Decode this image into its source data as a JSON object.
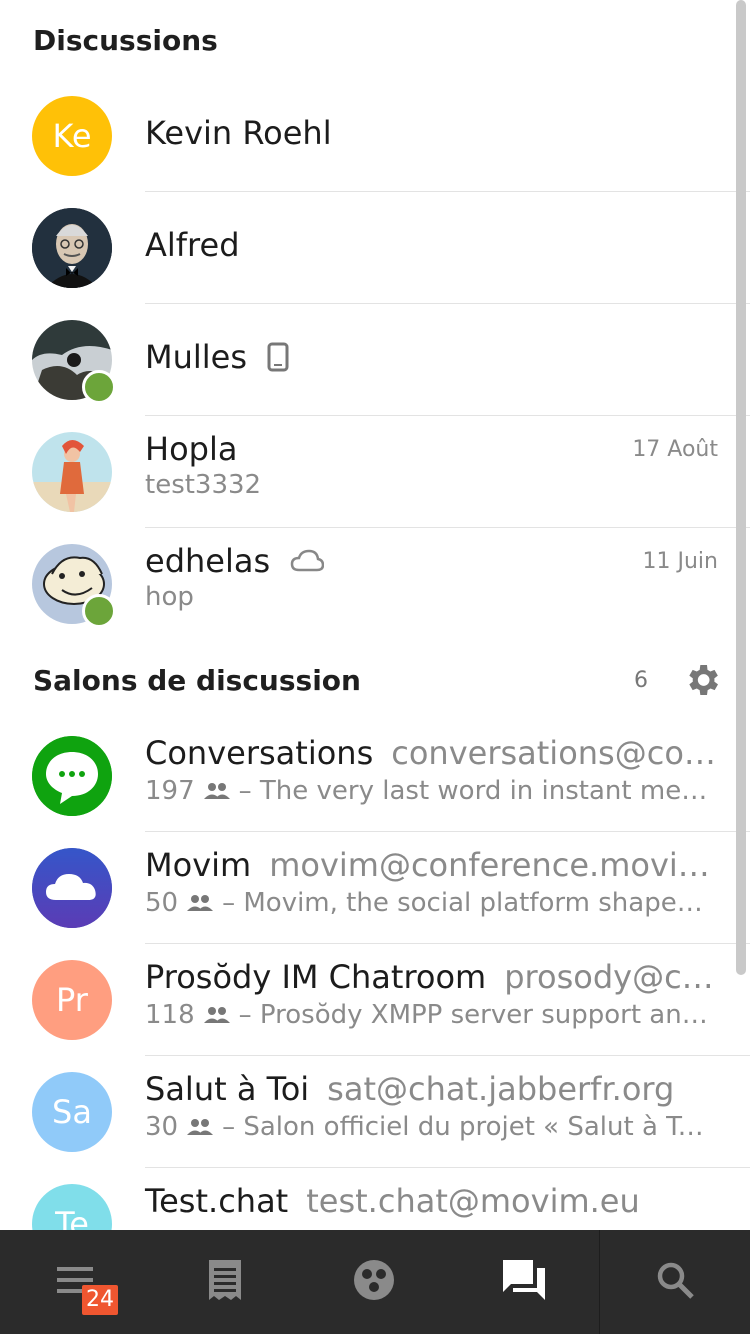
{
  "discussions": {
    "title": "Discussions",
    "contacts": [
      {
        "initials": "Ke",
        "name": "Kevin Roehl",
        "color": "#ffc107"
      },
      {
        "name": "Alfred"
      },
      {
        "name": "Mulles",
        "status_icon": "phone-icon",
        "online": true
      },
      {
        "name": "Hopla",
        "date": "17 Août",
        "last_message": "test3332"
      },
      {
        "name": "edhelas",
        "status_icon": "cloud-icon",
        "online": true,
        "date": "11 Juin",
        "last_message": "hop"
      }
    ]
  },
  "rooms": {
    "title": "Salons de discussion",
    "count": "6",
    "items": [
      {
        "name": "Conversations",
        "jid": "conversations@conference.siacs.eu",
        "users": "197",
        "description": "– The very last word in instant messaging",
        "color": "#0fa30f"
      },
      {
        "name": "Movim",
        "jid": "movim@conference.movim.eu",
        "users": "50",
        "description": "– Movim, the social platform shaped for your community",
        "color": "#3f51b5"
      },
      {
        "initials": "Pr",
        "name": "Prosŏdy IM Chatroom",
        "jid": "prosody@conference.prosody.im",
        "users": "118",
        "description": "– Prosŏdy XMPP server support and discussion",
        "color": "#ff9e80"
      },
      {
        "initials": "Sa",
        "name": "Salut à Toi",
        "jid": "sat@chat.jabberfr.org",
        "users": "30",
        "description": "– Salon officiel du projet « Salut à Toi »",
        "color": "#90caf9"
      },
      {
        "initials": "Te",
        "name": "Test.chat",
        "jid": "test.chat@movim.eu",
        "color": "#80deea"
      }
    ]
  },
  "bottom_nav": {
    "menu_badge": "24",
    "tabs": [
      "menu-icon",
      "news-icon",
      "communities-icon",
      "chat-icon",
      "search-icon"
    ]
  }
}
